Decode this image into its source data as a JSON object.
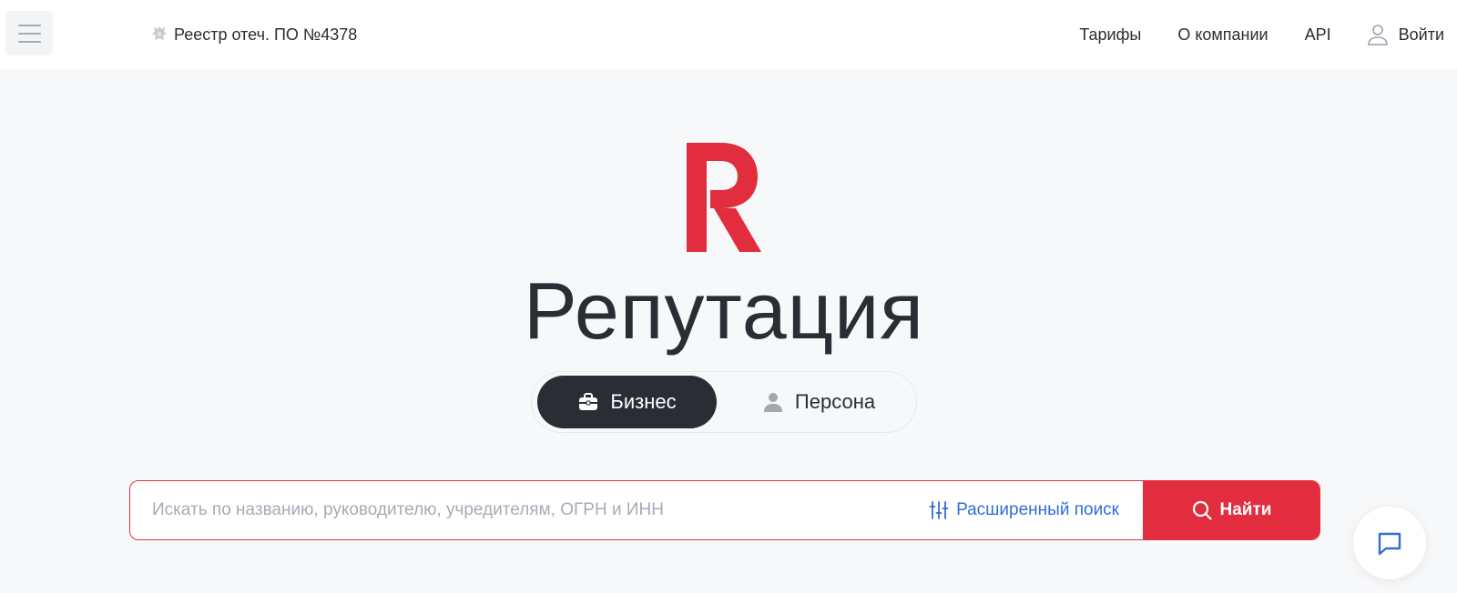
{
  "header": {
    "menu_icon": "hamburger-icon",
    "registry_text": "Реестр отеч. ПО №4378",
    "registry_icon": "coat-of-arms-icon",
    "nav": [
      "Тарифы",
      "О компании",
      "API"
    ],
    "login_label": "Войти",
    "login_icon": "user-icon"
  },
  "hero": {
    "logo_icon": "r-logo-icon",
    "title": "Репутация",
    "tabs": [
      {
        "label": "Бизнес",
        "icon": "briefcase-icon",
        "active": true
      },
      {
        "label": "Персона",
        "icon": "person-icon",
        "active": false
      }
    ]
  },
  "search": {
    "placeholder": "Искать по названию, руководителю, учредителям, ОГРН и ИНН",
    "value": "",
    "advanced_label": "Расширенный поиск",
    "advanced_icon": "sliders-icon",
    "submit_label": "Найти",
    "submit_icon": "search-icon"
  },
  "chat": {
    "icon": "chat-icon"
  },
  "colors": {
    "accent_red": "#e22d3e",
    "dark": "#2b2d35",
    "link_blue": "#2f6fd6",
    "background": "#f7f8fa"
  }
}
